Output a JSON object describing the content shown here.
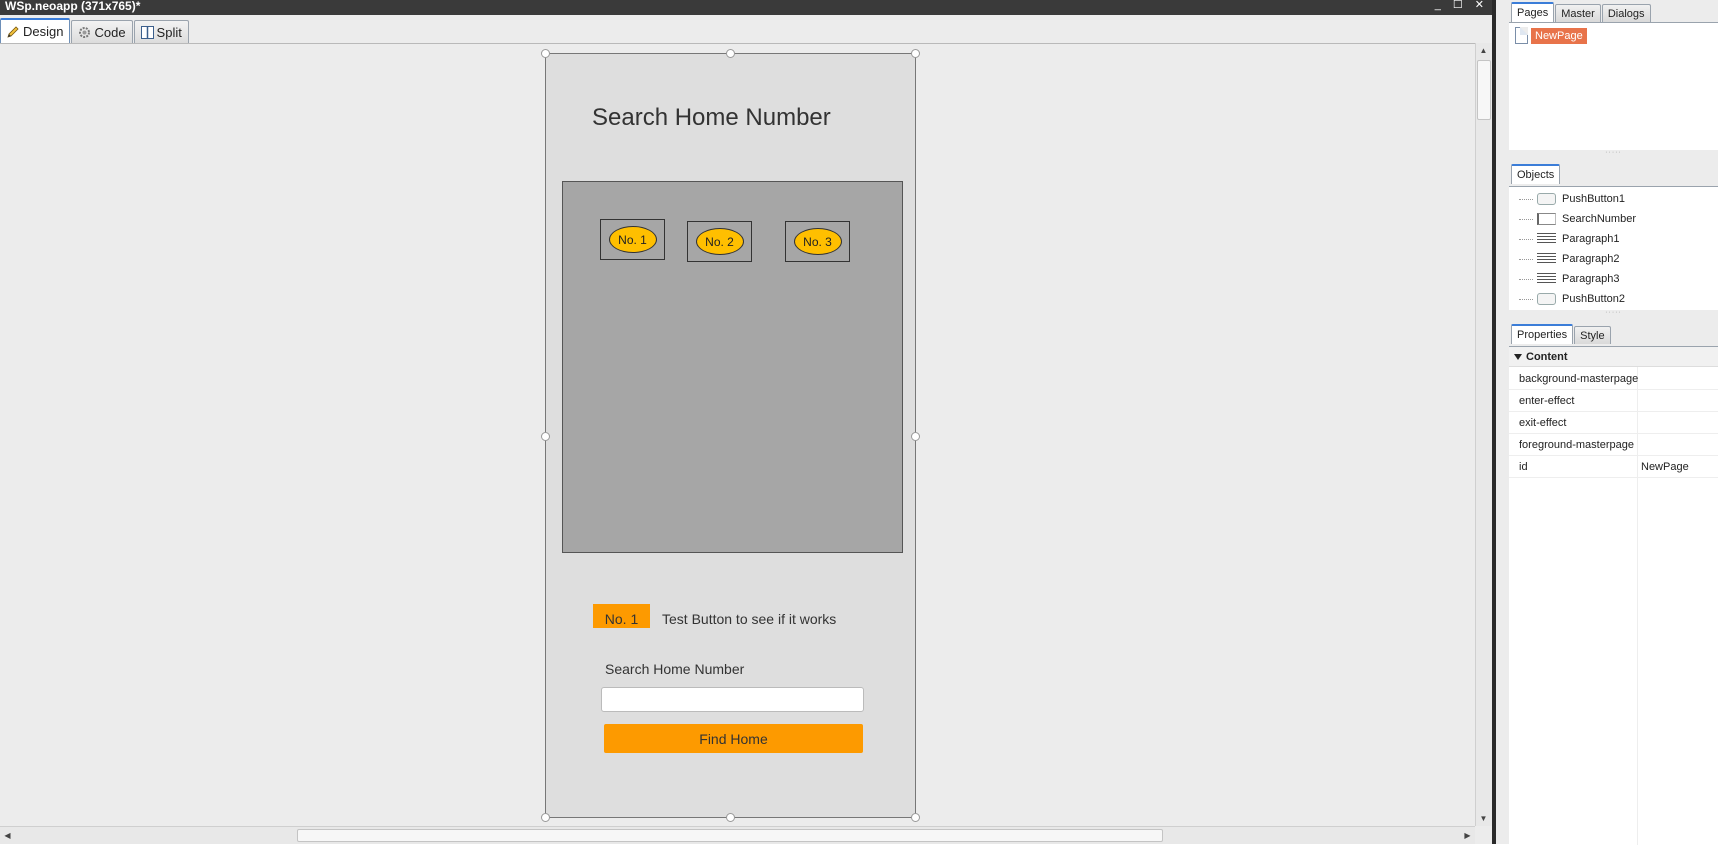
{
  "window": {
    "title": "WSp.neoapp (371x765)*",
    "controls": [
      "_",
      "☐",
      "✕"
    ]
  },
  "view_tabs": [
    {
      "label": "Design",
      "icon": "pencil-icon",
      "active": true
    },
    {
      "label": "Code",
      "icon": "gear-icon",
      "active": false
    },
    {
      "label": "Split",
      "icon": "split-icon",
      "active": false
    }
  ],
  "page": {
    "title": "Search Home Number",
    "homes": [
      {
        "label": "No. 1"
      },
      {
        "label": "No. 2"
      },
      {
        "label": "No. 3"
      }
    ],
    "test_button": {
      "label": "No. 1"
    },
    "test_caption": "Test Button to see if it works",
    "search_label": "Search Home Number",
    "search_value": "",
    "find_button": {
      "label": "Find Home"
    },
    "colors": {
      "accent": "#fd9a00",
      "oval": "#ffbf00",
      "panel": "#a6a6a6",
      "page": "#dedede"
    }
  },
  "pages_panel": {
    "tabs": [
      "Pages",
      "Master",
      "Dialogs"
    ],
    "active_tab": "Pages",
    "items": [
      {
        "label": "NewPage",
        "selected": true
      }
    ]
  },
  "objects_panel": {
    "tabs": [
      "Objects"
    ],
    "items": [
      {
        "label": "PushButton1",
        "icon": "button-icon"
      },
      {
        "label": "SearchNumber",
        "icon": "text-field-icon"
      },
      {
        "label": "Paragraph1",
        "icon": "paragraph-icon"
      },
      {
        "label": "Paragraph2",
        "icon": "paragraph-icon"
      },
      {
        "label": "Paragraph3",
        "icon": "paragraph-icon"
      },
      {
        "label": "PushButton2",
        "icon": "button-icon"
      }
    ]
  },
  "properties_panel": {
    "tabs": [
      "Properties",
      "Style"
    ],
    "section": "Content",
    "rows": [
      {
        "name": "background-masterpage",
        "value": ""
      },
      {
        "name": "enter-effect",
        "value": ""
      },
      {
        "name": "exit-effect",
        "value": ""
      },
      {
        "name": "foreground-masterpage",
        "value": ""
      },
      {
        "name": "id",
        "value": "NewPage"
      }
    ]
  }
}
